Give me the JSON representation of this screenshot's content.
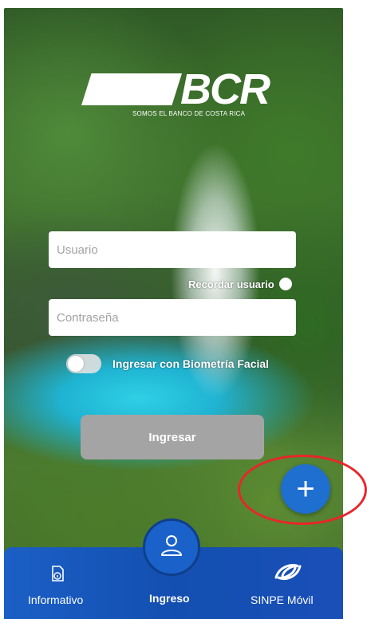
{
  "logo": {
    "brand": "BCR",
    "tagline": "SOMOS EL BANCO DE COSTA RICA"
  },
  "login": {
    "username_placeholder": "Usuario",
    "password_placeholder": "Contraseña",
    "remember_label": "Recordar usuario",
    "biometric_label": "Ingresar con Biometría Facial",
    "submit_label": "Ingresar"
  },
  "fab": {
    "icon": "plus-icon",
    "symbol": "+"
  },
  "bottom_nav": {
    "items": [
      {
        "label": "Informativo",
        "icon": "info-document-icon"
      },
      {
        "label": "Ingreso",
        "icon": "user-icon"
      },
      {
        "label": "SINPE Móvil",
        "icon": "sinpe-movil-icon"
      }
    ]
  },
  "colors": {
    "nav_blue": "#1b5fc6",
    "fab_blue": "#1f6fd0",
    "button_gray": "#a4a4a4",
    "annotation_red": "#e8262a"
  }
}
